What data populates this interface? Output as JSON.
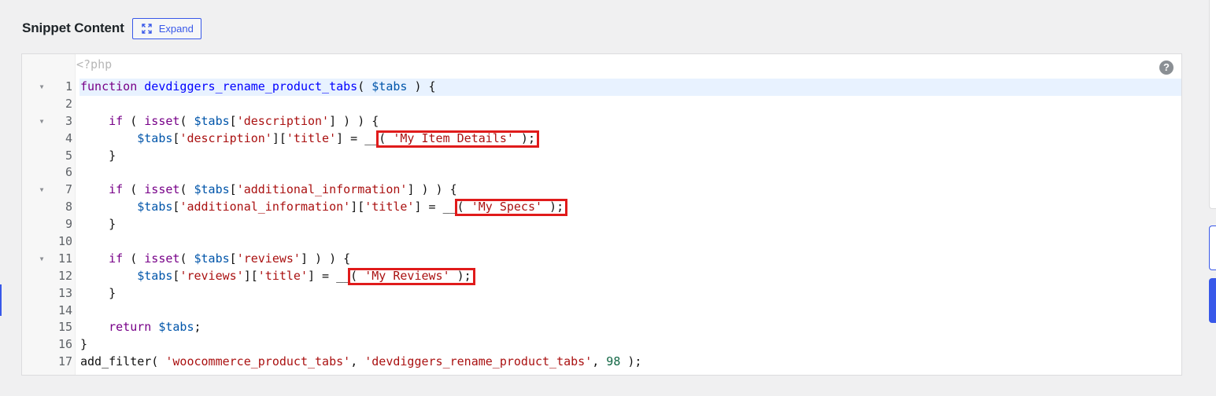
{
  "header": {
    "title": "Snippet Content",
    "expand_label": "Expand"
  },
  "editor": {
    "php_open_tag": "<?php",
    "help_glyph": "?",
    "lines": [
      {
        "num": "1",
        "fold": true,
        "active": true,
        "tokens": [
          {
            "t": "function",
            "c": "keyword"
          },
          {
            "t": " "
          },
          {
            "t": "devdiggers_rename_product_tabs",
            "c": "def"
          },
          {
            "t": "( "
          },
          {
            "t": "$tabs",
            "c": "variable"
          },
          {
            "t": " ) {"
          }
        ]
      },
      {
        "num": "2",
        "tokens": []
      },
      {
        "num": "3",
        "fold": true,
        "tokens": [
          {
            "t": "    "
          },
          {
            "t": "if",
            "c": "keyword"
          },
          {
            "t": " ( "
          },
          {
            "t": "isset",
            "c": "keyword"
          },
          {
            "t": "( "
          },
          {
            "t": "$tabs",
            "c": "variable"
          },
          {
            "t": "["
          },
          {
            "t": "'description'",
            "c": "string"
          },
          {
            "t": "] ) ) {"
          }
        ]
      },
      {
        "num": "4",
        "tokens": [
          {
            "t": "        "
          },
          {
            "t": "$tabs",
            "c": "variable"
          },
          {
            "t": "["
          },
          {
            "t": "'description'",
            "c": "string"
          },
          {
            "t": "]["
          },
          {
            "t": "'title'",
            "c": "string"
          },
          {
            "t": "] = __( "
          },
          {
            "t": "'My Item Details'",
            "c": "string"
          },
          {
            "t": " );"
          }
        ]
      },
      {
        "num": "5",
        "tokens": [
          {
            "t": "    }"
          }
        ]
      },
      {
        "num": "6",
        "tokens": []
      },
      {
        "num": "7",
        "fold": true,
        "tokens": [
          {
            "t": "    "
          },
          {
            "t": "if",
            "c": "keyword"
          },
          {
            "t": " ( "
          },
          {
            "t": "isset",
            "c": "keyword"
          },
          {
            "t": "( "
          },
          {
            "t": "$tabs",
            "c": "variable"
          },
          {
            "t": "["
          },
          {
            "t": "'additional_information'",
            "c": "string"
          },
          {
            "t": "] ) ) {"
          }
        ]
      },
      {
        "num": "8",
        "tokens": [
          {
            "t": "        "
          },
          {
            "t": "$tabs",
            "c": "variable"
          },
          {
            "t": "["
          },
          {
            "t": "'additional_information'",
            "c": "string"
          },
          {
            "t": "]["
          },
          {
            "t": "'title'",
            "c": "string"
          },
          {
            "t": "] = __( "
          },
          {
            "t": "'My Specs'",
            "c": "string"
          },
          {
            "t": " );"
          }
        ]
      },
      {
        "num": "9",
        "tokens": [
          {
            "t": "    }"
          }
        ]
      },
      {
        "num": "10",
        "tokens": []
      },
      {
        "num": "11",
        "fold": true,
        "tokens": [
          {
            "t": "    "
          },
          {
            "t": "if",
            "c": "keyword"
          },
          {
            "t": " ( "
          },
          {
            "t": "isset",
            "c": "keyword"
          },
          {
            "t": "( "
          },
          {
            "t": "$tabs",
            "c": "variable"
          },
          {
            "t": "["
          },
          {
            "t": "'reviews'",
            "c": "string"
          },
          {
            "t": "] ) ) {"
          }
        ]
      },
      {
        "num": "12",
        "tokens": [
          {
            "t": "        "
          },
          {
            "t": "$tabs",
            "c": "variable"
          },
          {
            "t": "["
          },
          {
            "t": "'reviews'",
            "c": "string"
          },
          {
            "t": "]["
          },
          {
            "t": "'title'",
            "c": "string"
          },
          {
            "t": "] = __( "
          },
          {
            "t": "'My Reviews'",
            "c": "string"
          },
          {
            "t": " );"
          }
        ]
      },
      {
        "num": "13",
        "tokens": [
          {
            "t": "    }"
          }
        ]
      },
      {
        "num": "14",
        "tokens": []
      },
      {
        "num": "15",
        "tokens": [
          {
            "t": "    "
          },
          {
            "t": "return",
            "c": "keyword"
          },
          {
            "t": " "
          },
          {
            "t": "$tabs",
            "c": "variable"
          },
          {
            "t": ";"
          }
        ]
      },
      {
        "num": "16",
        "tokens": [
          {
            "t": "}"
          }
        ]
      },
      {
        "num": "17",
        "tokens": [
          {
            "t": "add_filter( "
          },
          {
            "t": "'woocommerce_product_tabs'",
            "c": "string"
          },
          {
            "t": ", "
          },
          {
            "t": "'devdiggers_rename_product_tabs'",
            "c": "string"
          },
          {
            "t": ", "
          },
          {
            "t": "98",
            "c": "number"
          },
          {
            "t": " );"
          }
        ]
      }
    ]
  },
  "highlight_annotations": [
    {
      "line": "4",
      "text": "( 'My Item Details' );"
    },
    {
      "line": "8",
      "text": "( 'My Specs' );"
    },
    {
      "line": "12",
      "text": "( 'My Reviews' );"
    }
  ],
  "colors": {
    "accent": "#3858e9",
    "highlight_box": "#e01b1b",
    "active_line": "#e8f2ff",
    "keyword": "#770088",
    "def": "#0000ff",
    "variable": "#0055aa",
    "string": "#aa1111",
    "number": "#116644"
  }
}
